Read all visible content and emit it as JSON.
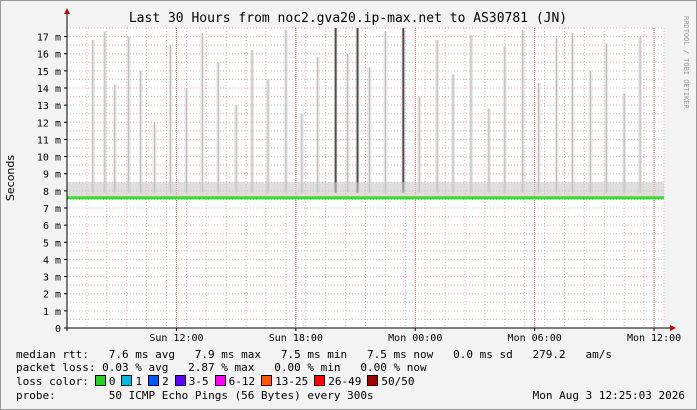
{
  "chart_data": {
    "type": "area",
    "title": "Last 30 Hours from noc2.gva20.ip-max.net to AS30781 (JN)",
    "ylabel": "Seconds",
    "ylim": [
      0,
      17.5
    ],
    "y_ticks": [
      "0",
      "1 m",
      "2 m",
      "3 m",
      "4 m",
      "5 m",
      "6 m",
      "7 m",
      "8 m",
      "9 m",
      "10 m",
      "11 m",
      "12 m",
      "13 m",
      "14 m",
      "15 m",
      "16 m",
      "17 m"
    ],
    "x_ticks": [
      "Sun 12:00",
      "Sun 18:00",
      "Mon 00:00",
      "Mon 06:00",
      "Mon 12:00"
    ],
    "x_range_hours": [
      0,
      30
    ],
    "x_tick_hours": [
      5.5,
      11.5,
      17.5,
      23.5,
      29.5
    ],
    "median_rtt_ms": 7.6,
    "spikes": [
      {
        "t": 1.3,
        "top": 16.8,
        "dark": false
      },
      {
        "t": 1.9,
        "top": 17.3,
        "dark": false
      },
      {
        "t": 2.4,
        "top": 14.2,
        "dark": false
      },
      {
        "t": 3.1,
        "top": 17.0,
        "dark": false
      },
      {
        "t": 3.7,
        "top": 15.0,
        "dark": false
      },
      {
        "t": 4.4,
        "top": 12.0,
        "dark": false
      },
      {
        "t": 5.2,
        "top": 16.5,
        "dark": false
      },
      {
        "t": 6.0,
        "top": 14.0,
        "dark": false
      },
      {
        "t": 6.8,
        "top": 17.2,
        "dark": false
      },
      {
        "t": 7.6,
        "top": 15.5,
        "dark": false
      },
      {
        "t": 8.5,
        "top": 13.0,
        "dark": false
      },
      {
        "t": 9.3,
        "top": 16.2,
        "dark": false
      },
      {
        "t": 10.1,
        "top": 14.5,
        "dark": false
      },
      {
        "t": 11.0,
        "top": 17.4,
        "dark": false
      },
      {
        "t": 11.8,
        "top": 12.5,
        "dark": false
      },
      {
        "t": 12.6,
        "top": 15.8,
        "dark": false
      },
      {
        "t": 13.5,
        "top": 17.5,
        "dark": true
      },
      {
        "t": 14.1,
        "top": 16.0,
        "dark": false
      },
      {
        "t": 14.6,
        "top": 17.5,
        "dark": true
      },
      {
        "t": 15.2,
        "top": 15.2,
        "dark": false
      },
      {
        "t": 16.0,
        "top": 17.3,
        "dark": false
      },
      {
        "t": 16.9,
        "top": 17.5,
        "dark": true
      },
      {
        "t": 17.7,
        "top": 13.5,
        "dark": false
      },
      {
        "t": 18.6,
        "top": 16.8,
        "dark": false
      },
      {
        "t": 19.4,
        "top": 14.8,
        "dark": false
      },
      {
        "t": 20.3,
        "top": 17.1,
        "dark": false
      },
      {
        "t": 21.2,
        "top": 12.8,
        "dark": false
      },
      {
        "t": 22.0,
        "top": 16.4,
        "dark": false
      },
      {
        "t": 22.9,
        "top": 17.4,
        "dark": false
      },
      {
        "t": 23.7,
        "top": 14.3,
        "dark": false
      },
      {
        "t": 24.6,
        "top": 16.9,
        "dark": false
      },
      {
        "t": 25.4,
        "top": 17.2,
        "dark": false
      },
      {
        "t": 26.3,
        "top": 15.0,
        "dark": false
      },
      {
        "t": 27.1,
        "top": 16.6,
        "dark": false
      },
      {
        "t": 28.0,
        "top": 13.7,
        "dark": false
      },
      {
        "t": 28.8,
        "top": 17.0,
        "dark": false
      }
    ]
  },
  "watermark": "RRDTOOL / TOBI OETIKER",
  "colors": {
    "background": "#f3f3f3",
    "plot_bg": "#ffffff",
    "grid_minor": "#e8b4b4",
    "grid_major": "#d26a6a",
    "axis": "#000000",
    "median": "#44d63a",
    "arrow": "#c80000",
    "smoke_light": "#d8d8d8",
    "smoke_dark": "#505050"
  },
  "stats": {
    "line1": "median rtt:   7.6 ms avg   7.9 ms max   7.5 ms min   7.5 ms now   0.0 ms sd   279.2   am/s",
    "line2": "packet loss: 0.03 % avg   2.87 % max   0.00 % min   0.00 % now"
  },
  "loss_legend": {
    "label": "loss color:",
    "items": [
      {
        "label": "0",
        "color": "#26d026"
      },
      {
        "label": "1",
        "color": "#00b8e4"
      },
      {
        "label": "2",
        "color": "#0059ff"
      },
      {
        "label": "3-5",
        "color": "#5e00ff"
      },
      {
        "label": "6-12",
        "color": "#ff00ff"
      },
      {
        "label": "13-25",
        "color": "#ff5500"
      },
      {
        "label": "26-49",
        "color": "#ff0000"
      },
      {
        "label": "50/50",
        "color": "#a10000"
      }
    ]
  },
  "probe": {
    "label": "probe:",
    "text": "50 ICMP Echo Pings (56 Bytes) every 300s",
    "date": "Mon Aug  3 12:25:03 2026"
  }
}
